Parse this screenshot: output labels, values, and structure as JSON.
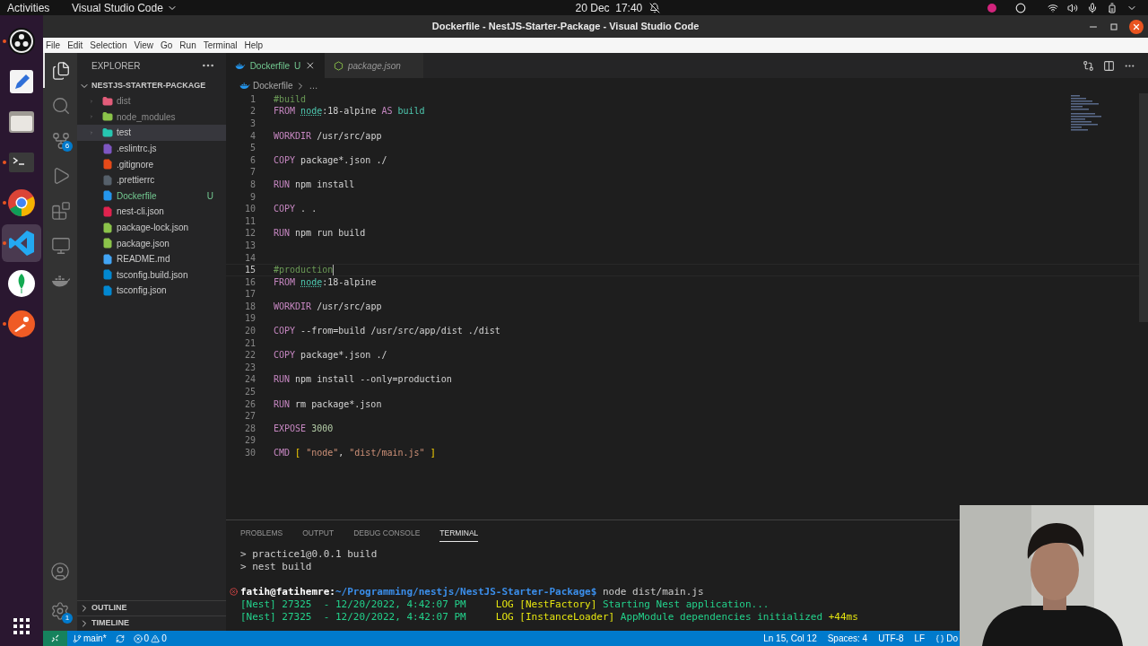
{
  "top_bar": {
    "activities": "Activities",
    "app_menu": "Visual Studio Code",
    "clock": "20 Dec  17:40"
  },
  "dock": [
    {
      "kind": "obs",
      "running": true,
      "selected": false
    },
    {
      "kind": "editor",
      "running": false,
      "selected": false
    },
    {
      "kind": "files",
      "running": false,
      "selected": false
    },
    {
      "kind": "terminal",
      "running": true,
      "selected": false
    },
    {
      "kind": "browser",
      "running": true,
      "selected": false
    },
    {
      "kind": "code",
      "running": true,
      "selected": true
    },
    {
      "kind": "leaf",
      "running": false,
      "selected": false
    },
    {
      "kind": "postman",
      "running": true,
      "selected": false
    }
  ],
  "window": {
    "title": "Dockerfile - NestJS-Starter-Package - Visual Studio Code"
  },
  "menu": [
    "File",
    "Edit",
    "Selection",
    "View",
    "Go",
    "Run",
    "Terminal",
    "Help"
  ],
  "activity_bar": [
    {
      "kind": "explorer",
      "selected": true
    },
    {
      "kind": "search",
      "selected": false
    },
    {
      "kind": "source_control",
      "selected": false,
      "badge": "6"
    },
    {
      "kind": "run",
      "selected": false
    },
    {
      "kind": "extensions",
      "selected": false
    },
    {
      "kind": "remote",
      "selected": false
    },
    {
      "kind": "docker",
      "selected": false
    }
  ],
  "activity_bar_bottom": [
    {
      "kind": "account"
    },
    {
      "kind": "settings",
      "badge": "1"
    }
  ],
  "explorer": {
    "title": "EXPLORER",
    "root": {
      "label": "NESTJS-STARTER-PACKAGE",
      "expanded": true
    },
    "items": [
      {
        "name": "dist",
        "kind": "folder",
        "color": "#e35d7a",
        "expanded": false,
        "selected": false,
        "ignored": true
      },
      {
        "name": "node_modules",
        "kind": "folder",
        "color": "#8bc34a",
        "expanded": false,
        "selected": false,
        "ignored": true
      },
      {
        "name": "test",
        "kind": "folder",
        "color": "#26c6b0",
        "expanded": false,
        "selected": true,
        "ignored": false
      },
      {
        "name": ".eslintrc.js",
        "kind": "file",
        "color": "#7e57c2",
        "selected": false,
        "ignored": false
      },
      {
        "name": ".gitignore",
        "kind": "file",
        "color": "#e64a19",
        "selected": false,
        "ignored": false
      },
      {
        "name": ".prettierrc",
        "kind": "file",
        "color": "#56606a",
        "selected": false,
        "ignored": false
      },
      {
        "name": "Dockerfile",
        "kind": "file",
        "color": "#2496ed",
        "selected": false,
        "ignored": false,
        "badge": "U"
      },
      {
        "name": "nest-cli.json",
        "kind": "file",
        "color": "#e0234e",
        "selected": false,
        "ignored": false
      },
      {
        "name": "package-lock.json",
        "kind": "file",
        "color": "#8bc34a",
        "selected": false,
        "ignored": false
      },
      {
        "name": "package.json",
        "kind": "file",
        "color": "#8bc34a",
        "selected": false,
        "ignored": false
      },
      {
        "name": "README.md",
        "kind": "file",
        "color": "#42a5f5",
        "selected": false,
        "ignored": false
      },
      {
        "name": "tsconfig.build.json",
        "kind": "file",
        "color": "#0288d1",
        "selected": false,
        "ignored": false
      },
      {
        "name": "tsconfig.json",
        "kind": "file",
        "color": "#0288d1",
        "selected": false,
        "ignored": false
      }
    ]
  },
  "sidebar_sections": [
    {
      "label": "OUTLINE",
      "expanded": false
    },
    {
      "label": "TIMELINE",
      "expanded": false
    }
  ],
  "tabs": [
    {
      "label": "Dockerfile",
      "badge": "U",
      "selected": true,
      "preview": false
    },
    {
      "label": "package.json",
      "selected": false,
      "preview": true
    }
  ],
  "breadcrumb": {
    "file": "Dockerfile",
    "rest": "…"
  },
  "code": {
    "lines": [
      {
        "number": "1",
        "tokens": [
          {
            "text": "#build",
            "kind": "comment"
          }
        ]
      },
      {
        "number": "2",
        "tokens": [
          {
            "text": "FROM ",
            "kind": "keyword"
          },
          {
            "text": "node"
          },
          {
            "text": ":18-alpine ",
            "kind": "plain"
          },
          {
            "text": "AS",
            "kind": "keyword"
          },
          {
            "text": " build",
            "kind": "variable"
          }
        ]
      },
      {
        "number": "3"
      },
      {
        "number": "4",
        "tokens": [
          {
            "text": "WORKDIR",
            "kind": "keyword"
          },
          {
            "text": " /usr/src/app",
            "kind": "plain"
          }
        ]
      },
      {
        "number": "5"
      },
      {
        "number": "6",
        "tokens": [
          {
            "text": "COPY",
            "kind": "keyword"
          },
          {
            "text": " package*.json ./",
            "kind": "plain"
          }
        ]
      },
      {
        "number": "7"
      },
      {
        "number": "8",
        "tokens": [
          {
            "text": "RUN",
            "kind": "keyword"
          },
          {
            "text": " npm install",
            "kind": "plain"
          }
        ]
      },
      {
        "number": "9"
      },
      {
        "number": "10",
        "tokens": [
          {
            "text": "COPY",
            "kind": "keyword"
          },
          {
            "text": " . .",
            "kind": "plain"
          }
        ]
      },
      {
        "number": "11"
      },
      {
        "number": "12",
        "tokens": [
          {
            "text": "RUN",
            "kind": "keyword"
          },
          {
            "text": " npm run build",
            "kind": "plain"
          }
        ]
      },
      {
        "number": "13"
      },
      {
        "number": "14"
      },
      {
        "number": "15",
        "current": true,
        "tokens": [
          {
            "text": "#production",
            "kind": "comment"
          }
        ]
      },
      {
        "number": "16",
        "tokens": [
          {
            "text": "FROM ",
            "kind": "keyword"
          },
          {
            "text": "node"
          },
          {
            "text": ":18-alpine",
            "kind": "plain"
          }
        ]
      },
      {
        "number": "17"
      },
      {
        "number": "18",
        "tokens": [
          {
            "text": "WORKDIR",
            "kind": "keyword"
          },
          {
            "text": " /usr/src/app",
            "kind": "plain"
          }
        ]
      },
      {
        "number": "19"
      },
      {
        "number": "20",
        "tokens": [
          {
            "text": "COPY",
            "kind": "keyword"
          },
          {
            "text": " --from=build /usr/src/app/dist ./dist",
            "kind": "plain"
          }
        ]
      },
      {
        "number": "21"
      },
      {
        "number": "22",
        "tokens": [
          {
            "text": "COPY",
            "kind": "keyword"
          },
          {
            "text": " package*.json ./",
            "kind": "plain"
          }
        ]
      },
      {
        "number": "23"
      },
      {
        "number": "24",
        "tokens": [
          {
            "text": "RUN",
            "kind": "keyword"
          },
          {
            "text": " npm install --only=production",
            "kind": "plain"
          }
        ]
      },
      {
        "number": "25"
      },
      {
        "number": "26",
        "tokens": [
          {
            "text": "RUN",
            "kind": "keyword"
          },
          {
            "text": " rm package*.json",
            "kind": "plain"
          }
        ]
      },
      {
        "number": "27"
      },
      {
        "number": "28",
        "tokens": [
          {
            "text": "EXPOSE",
            "kind": "keyword"
          },
          {
            "text": " 3000",
            "kind": "number"
          }
        ]
      },
      {
        "number": "29"
      },
      {
        "number": "30",
        "tokens": [
          {
            "text": "CMD",
            "kind": "keyword"
          },
          {
            "text": " [",
            "kind": "bracket"
          },
          {
            "text": " \"node\"",
            "kind": "string"
          },
          {
            "text": ", ",
            "kind": "plain"
          },
          {
            "text": "\"dist/main.js\"",
            "kind": "string"
          },
          {
            "text": " ]",
            "kind": "bracket"
          }
        ]
      }
    ]
  },
  "panel": {
    "tabs": [
      {
        "label": "PROBLEMS",
        "selected": false
      },
      {
        "label": "OUTPUT",
        "selected": false
      },
      {
        "label": "DEBUG CONSOLE",
        "selected": false
      },
      {
        "label": "TERMINAL",
        "selected": true
      }
    ],
    "terminal": [
      {
        "spans": [
          {
            "text": "> practice1@0.0.1 build",
            "kind": "plain"
          }
        ]
      },
      {
        "spans": [
          {
            "text": "> nest build",
            "kind": "plain"
          }
        ]
      },
      {
        "blank_before": true,
        "error": true,
        "spans": [
          {
            "text": "fatih@fatihemre:",
            "kind": "user"
          },
          {
            "text": "~/Programming/nestjs/NestJS-Starter-Package$",
            "kind": "path"
          },
          {
            "text": " node dist/main.js",
            "kind": "plain"
          }
        ]
      },
      {
        "spans": [
          {
            "text": "[Nest] 27325  - 12/20/2022, 4:42:07 PM",
            "kind": "green"
          },
          {
            "text": "     LOG [NestFactory]",
            "kind": "yellow"
          },
          {
            "text": " Starting Nest application...",
            "kind": "green"
          }
        ]
      },
      {
        "spans": [
          {
            "text": "[Nest] 27325  - 12/20/2022, 4:42:07 PM",
            "kind": "green"
          },
          {
            "text": "     LOG [InstanceLoader]",
            "kind": "yellow"
          },
          {
            "text": " AppModule dependencies initialized",
            "kind": "green"
          },
          {
            "text": " +44ms",
            "kind": "yellow"
          }
        ]
      }
    ]
  },
  "status_bar": {
    "branch": "main*",
    "errors": "0",
    "warnings": "0",
    "right": [
      "Ln 15, Col 12",
      "Spaces: 4",
      "UTF-8",
      "LF"
    ],
    "language": "Do"
  }
}
